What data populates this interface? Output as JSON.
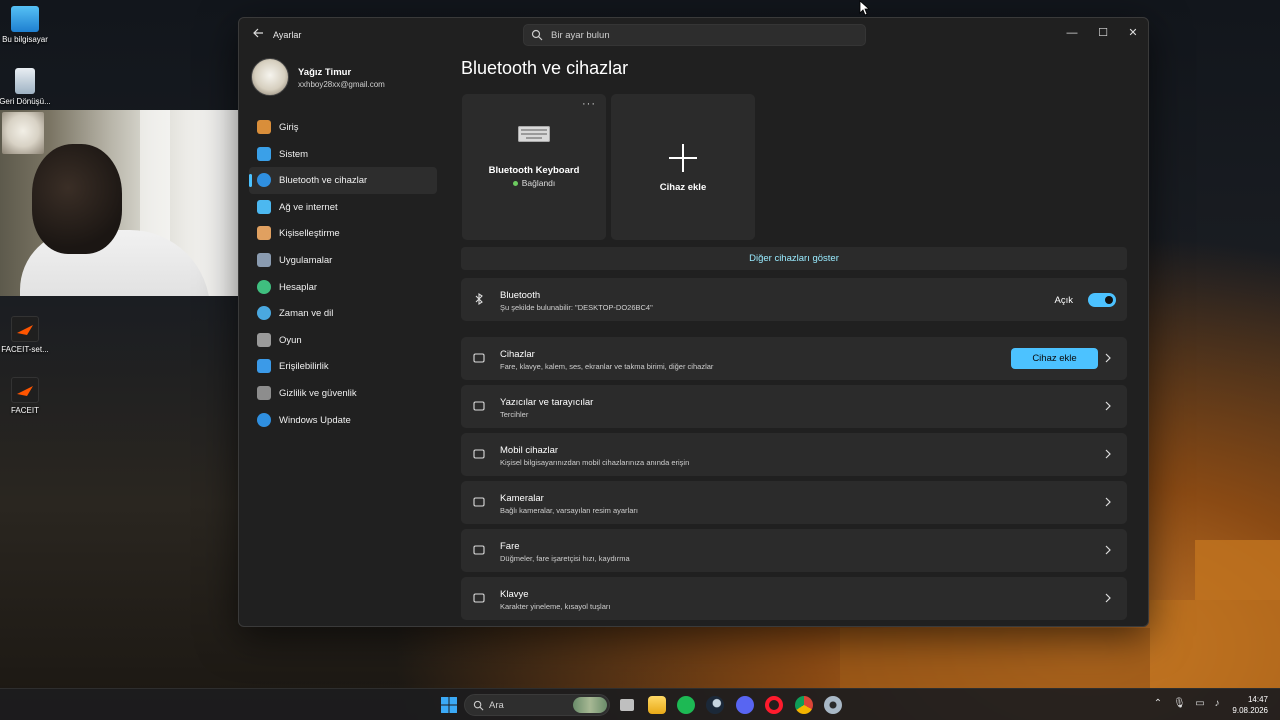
{
  "desktop": {
    "icons": [
      {
        "label": "Bu bilgisayar",
        "icon": "monitor-icon"
      },
      {
        "label": "Geri Dönüşü...",
        "icon": "recycle-bin-icon"
      },
      {
        "label": "FACEIT-set...",
        "icon": "faceit-icon"
      },
      {
        "label": "FACEIT",
        "icon": "faceit-icon"
      }
    ]
  },
  "window": {
    "app_title": "Ayarlar",
    "search_placeholder": "Bir ayar bulun",
    "controls": {
      "minimize": "—",
      "maximize": "☐",
      "close": "✕"
    }
  },
  "profile": {
    "name": "Yağız Timur",
    "email": "xxhboy28xx@gmail.com"
  },
  "sidebar": {
    "items": [
      {
        "label": "Giriş",
        "icon": "home-icon",
        "color": "#d98e3a"
      },
      {
        "label": "Sistem",
        "icon": "system-icon",
        "color": "#3aa0e8"
      },
      {
        "label": "Bluetooth ve cihazlar",
        "icon": "bluetooth-icon",
        "color": "#2f8fe0",
        "active": true
      },
      {
        "label": "Ağ ve internet",
        "icon": "wifi-icon",
        "color": "#4cb8f0"
      },
      {
        "label": "Kişiselleştirme",
        "icon": "brush-icon",
        "color": "#e0a060"
      },
      {
        "label": "Uygulamalar",
        "icon": "apps-icon",
        "color": "#8a9bb0"
      },
      {
        "label": "Hesaplar",
        "icon": "account-icon",
        "color": "#3fbf7f"
      },
      {
        "label": "Zaman ve dil",
        "icon": "clock-globe-icon",
        "color": "#4aa8e0"
      },
      {
        "label": "Oyun",
        "icon": "gamepad-icon",
        "color": "#9a9a9a"
      },
      {
        "label": "Erişilebilirlik",
        "icon": "accessibility-icon",
        "color": "#3b9ae8"
      },
      {
        "label": "Gizlilik ve güvenlik",
        "icon": "shield-icon",
        "color": "#8d8d8d"
      },
      {
        "label": "Windows Update",
        "icon": "update-icon",
        "color": "#2f8fe0"
      }
    ]
  },
  "main": {
    "title": "Bluetooth ve cihazlar",
    "device_card": {
      "name": "Bluetooth Keyboard",
      "status": "Bağlandı",
      "more": "···"
    },
    "add_card": {
      "label": "Cihaz ekle"
    },
    "show_more": "Diğer cihazları göster",
    "bluetooth_row": {
      "title": "Bluetooth",
      "subtitle": "Şu şekilde bulunabilir: \"DESKTOP-DO26BC4\"",
      "toggle_label": "Açık",
      "toggle_on": true
    },
    "rows": [
      {
        "title": "Cihazlar",
        "subtitle": "Fare, klavye, kalem, ses, ekranlar ve takma birimi, diğer cihazlar",
        "icon": "devices-icon",
        "button": "Cihaz ekle"
      },
      {
        "title": "Yazıcılar ve tarayıcılar",
        "subtitle": "Tercihler",
        "icon": "printer-icon"
      },
      {
        "title": "Mobil cihazlar",
        "subtitle": "Kişisel bilgisayarınızdan mobil cihazlarınıza anında erişin",
        "icon": "phone-icon"
      },
      {
        "title": "Kameralar",
        "subtitle": "Bağlı kameralar, varsayılan resim ayarları",
        "icon": "camera-icon"
      },
      {
        "title": "Fare",
        "subtitle": "Düğmeler, fare işaretçisi hızı, kaydırma",
        "icon": "mouse-icon"
      },
      {
        "title": "Klavye",
        "subtitle": "Karakter yineleme, kısayol tuşları",
        "icon": "keyboard-icon"
      }
    ]
  },
  "taskbar": {
    "search_label": "Ara",
    "time": "14:47",
    "date": "9.08.2026"
  },
  "colors": {
    "accent": "#4cc2ff",
    "link": "#99ebff",
    "card": "#2b2b2b",
    "window": "#202020"
  }
}
